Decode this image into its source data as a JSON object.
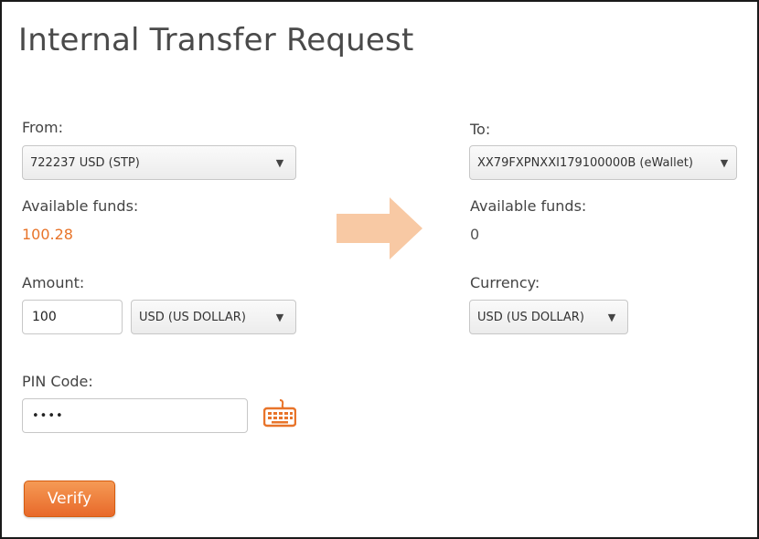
{
  "page": {
    "title": "Internal Transfer Request"
  },
  "from": {
    "label": "From:",
    "account": "722237 USD (STP)",
    "available_label": "Available funds:",
    "available_value": "100.28",
    "amount_label": "Amount:",
    "amount_value": "100",
    "amount_currency": "USD (US DOLLAR)",
    "pin_label": "PIN Code:",
    "pin_value": "••••"
  },
  "to": {
    "label": "To:",
    "account": "XX79FXPNXXI179100000B (eWallet)",
    "available_label": "Available funds:",
    "available_value": "0",
    "currency_label": "Currency:",
    "currency_value": "USD (US DOLLAR)"
  },
  "actions": {
    "verify_label": "Verify"
  },
  "icons": {
    "dropdown": "chevron-down-icon",
    "transfer_arrow": "arrow-right-icon",
    "keyboard": "keyboard-icon"
  },
  "colors": {
    "accent": "#e8742a",
    "arrow": "#f8c9a4"
  }
}
